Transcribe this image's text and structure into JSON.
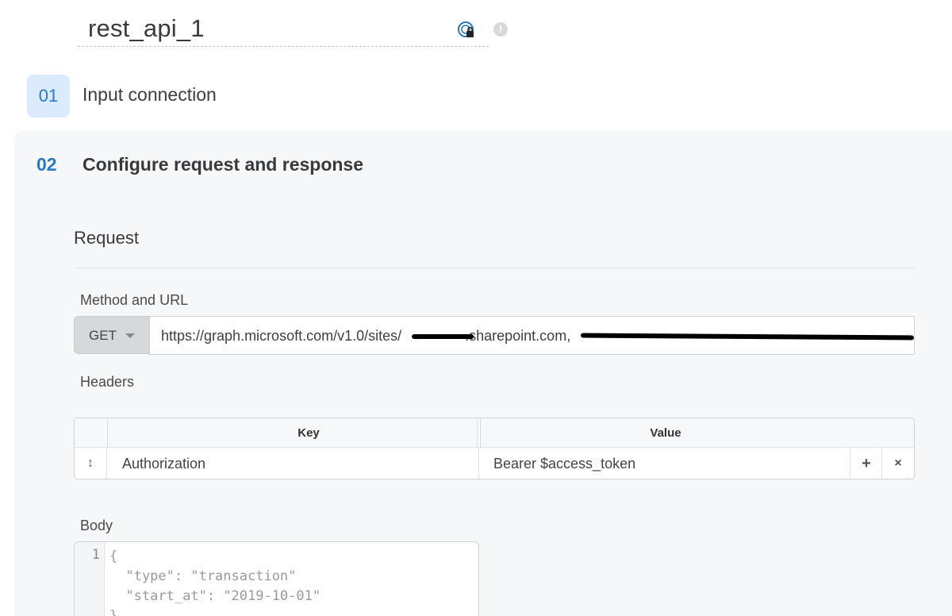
{
  "title": "rest_api_1",
  "icons": {
    "lock": "connection-lock-icon",
    "info": "info-icon"
  },
  "step1": {
    "number": "01",
    "label": "Input connection"
  },
  "step2": {
    "number": "02",
    "label": "Configure request and response"
  },
  "request": {
    "heading": "Request",
    "method_url_label": "Method and URL",
    "method": "GET",
    "url_prefix": "https://graph.microsoft.com/v1.0/sites/",
    "url_middle": ".sharepoint.com,"
  },
  "headers": {
    "label": "Headers",
    "columns": [
      "Key",
      "Value"
    ],
    "rows": [
      {
        "key": "Authorization",
        "value": "Bearer $access_token"
      }
    ],
    "add_symbol": "+",
    "remove_symbol": "×",
    "drag_symbol": "↕"
  },
  "body": {
    "label": "Body",
    "line_number": "1",
    "code": "{\n  \"type\": \"transaction\"\n  \"start_at\": \"2019-10-01\"\n}"
  },
  "colors": {
    "accent": "#2a78c5",
    "badge_bg": "#dcebfb",
    "panel_bg": "#f6f7f8"
  }
}
